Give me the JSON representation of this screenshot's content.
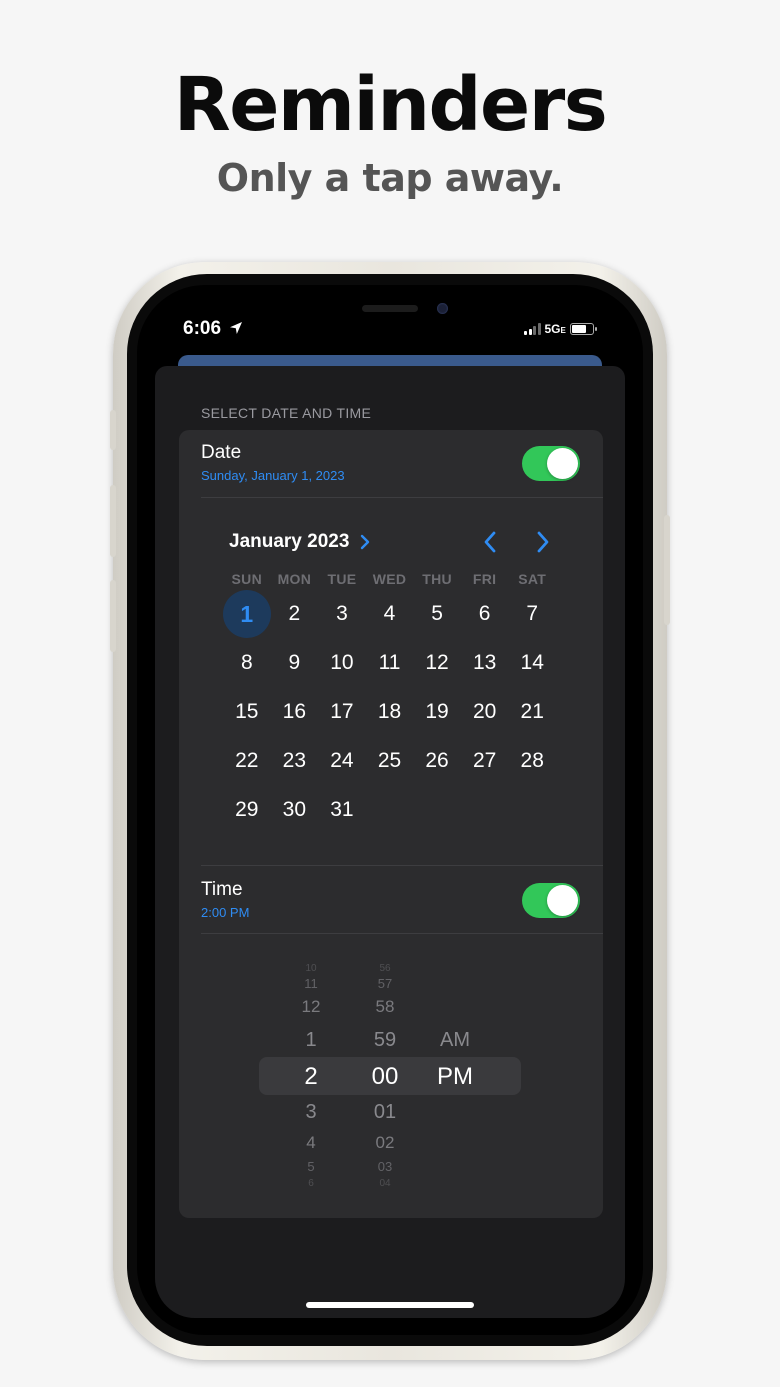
{
  "promo": {
    "title": "Reminders",
    "subtitle": "Only a tap away."
  },
  "status_bar": {
    "time": "6:06",
    "network": "5G",
    "network_suffix": "E"
  },
  "sheet": {
    "section_header": "SELECT DATE AND TIME",
    "date_row": {
      "label": "Date",
      "value": "Sunday, January 1, 2023",
      "toggle_on": true
    },
    "calendar": {
      "month_label": "January 2023",
      "weekdays": [
        "SUN",
        "MON",
        "TUE",
        "WED",
        "THU",
        "FRI",
        "SAT"
      ],
      "selected_day": "1",
      "days": [
        "1",
        "2",
        "3",
        "4",
        "5",
        "6",
        "7",
        "8",
        "9",
        "10",
        "11",
        "12",
        "13",
        "14",
        "15",
        "16",
        "17",
        "18",
        "19",
        "20",
        "21",
        "22",
        "23",
        "24",
        "25",
        "26",
        "27",
        "28",
        "29",
        "30",
        "31"
      ]
    },
    "time_row": {
      "label": "Time",
      "value": "2:00 PM",
      "toggle_on": true
    },
    "time_picker": {
      "hours_above": [
        "10",
        "11",
        "12",
        "1"
      ],
      "hour_current": "2",
      "hours_below": [
        "3",
        "4",
        "5",
        "6"
      ],
      "minutes_above": [
        "56",
        "57",
        "58",
        "59"
      ],
      "minute_current": "00",
      "minutes_below": [
        "01",
        "02",
        "03",
        "04"
      ],
      "period_above": "AM",
      "period_current": "PM"
    }
  },
  "colors": {
    "accent": "#2f8cf3",
    "toggle_on": "#32c759",
    "panel": "#2c2c2e",
    "sheet": "#1c1c1e"
  }
}
